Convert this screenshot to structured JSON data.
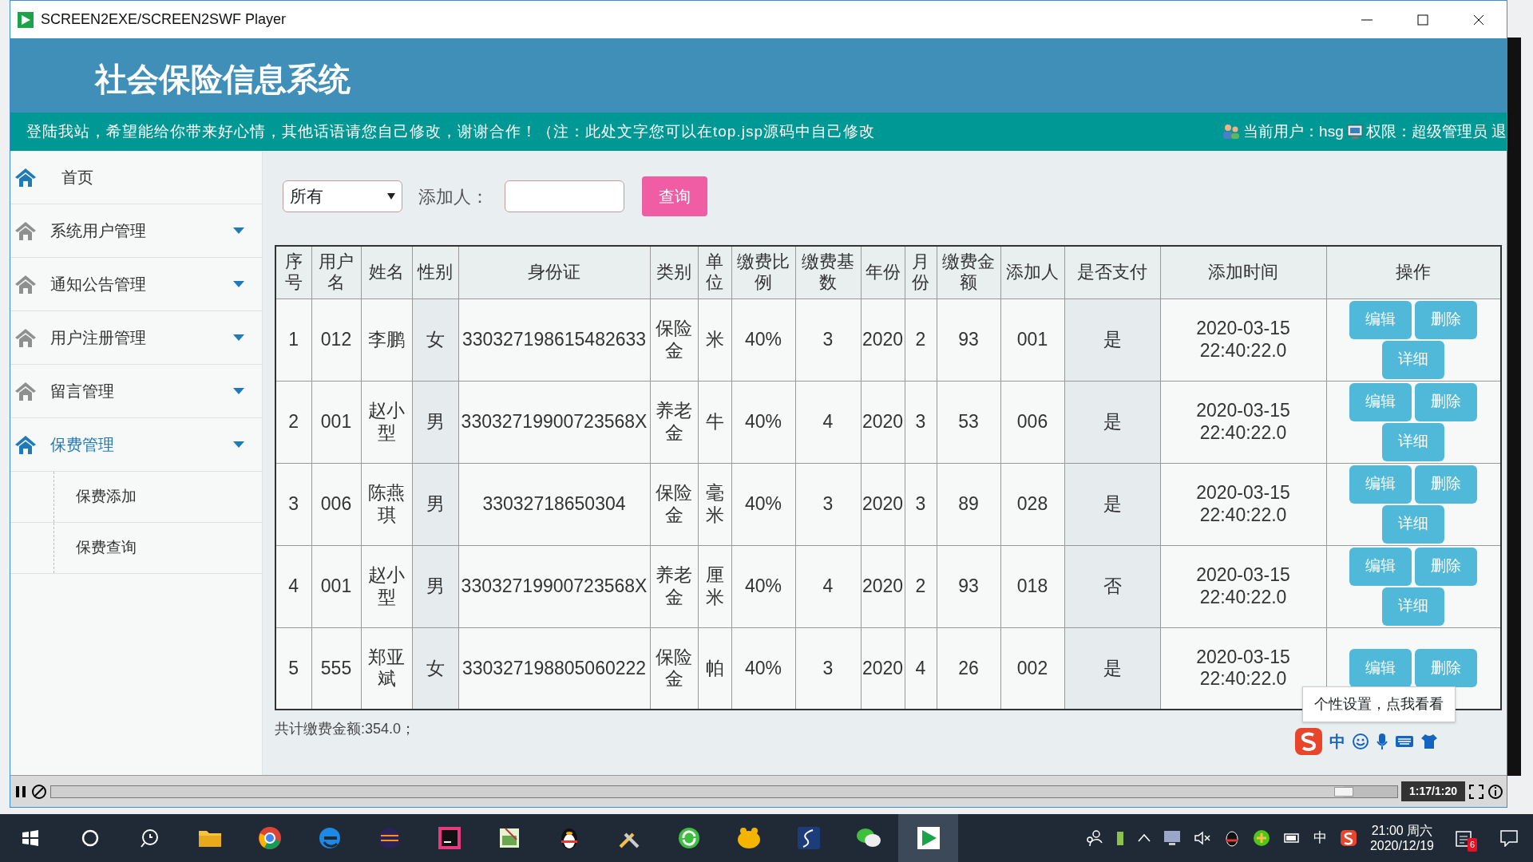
{
  "window": {
    "title": "SCREEN2EXE/SCREEN2SWF Player"
  },
  "header": {
    "title": "社会保险信息系统",
    "notice": "登陆我站，希望能给你带来好心情，其他话语请您自己修改，谢谢合作！（注：此处文字您可以在top.jsp源码中自己修改",
    "user": "当前用户：hsg",
    "role": "权限：超级管理员 退"
  },
  "sidebar": [
    {
      "label": "首页",
      "kind": "link"
    },
    {
      "label": "系统用户管理",
      "kind": "menu",
      "expanded": false
    },
    {
      "label": "通知公告管理",
      "kind": "menu",
      "expanded": false
    },
    {
      "label": "用户注册管理",
      "kind": "menu",
      "expanded": false
    },
    {
      "label": "留言管理",
      "kind": "menu",
      "expanded": false
    },
    {
      "label": "保费管理",
      "kind": "menu",
      "expanded": true,
      "children": [
        {
          "label": "保费添加"
        },
        {
          "label": "保费查询"
        }
      ]
    }
  ],
  "filter": {
    "select": "所有",
    "label": "添加人：",
    "button": "查询"
  },
  "table": {
    "columns": [
      "序号",
      "用户名",
      "姓名",
      "性别",
      "身份证",
      "类别",
      "单位",
      "缴费比例",
      "缴费基数",
      "年份",
      "月份",
      "缴费金额",
      "添加人",
      "是否支付",
      "添加时间",
      "操作"
    ],
    "rows": [
      {
        "cells": [
          "1",
          "012",
          "李鹏",
          "女",
          "330327198615482633",
          "保险金",
          "米",
          "40%",
          "3",
          "2020",
          "2",
          "93",
          "001",
          "是",
          "2020-03-15 22:40:22.0"
        ],
        "actions": [
          "编辑",
          "删除",
          "详细"
        ]
      },
      {
        "cells": [
          "2",
          "001",
          "赵小型",
          "男",
          "33032719900723568X",
          "养老金",
          "牛",
          "40%",
          "4",
          "2020",
          "3",
          "53",
          "006",
          "是",
          "2020-03-15 22:40:22.0"
        ],
        "actions": [
          "编辑",
          "删除",
          "详细"
        ]
      },
      {
        "cells": [
          "3",
          "006",
          "陈燕琪",
          "男",
          "33032718650304",
          "保险金",
          "毫米",
          "40%",
          "3",
          "2020",
          "3",
          "89",
          "028",
          "是",
          "2020-03-15 22:40:22.0"
        ],
        "actions": [
          "编辑",
          "删除",
          "详细"
        ]
      },
      {
        "cells": [
          "4",
          "001",
          "赵小型",
          "男",
          "33032719900723568X",
          "养老金",
          "厘米",
          "40%",
          "4",
          "2020",
          "2",
          "93",
          "018",
          "否",
          "2020-03-15 22:40:22.0"
        ],
        "actions": [
          "编辑",
          "删除",
          "详细"
        ]
      },
      {
        "cells": [
          "5",
          "555",
          "郑亚斌",
          "女",
          "330327198805060222",
          "保险金",
          "帕",
          "40%",
          "3",
          "2020",
          "4",
          "26",
          "002",
          "是",
          "2020-03-15 22:40:22.0"
        ],
        "actions": [
          "编辑",
          "删除"
        ]
      }
    ]
  },
  "total": "共计缴费金额:354.0；",
  "tooltip": "个性设置，点我看看",
  "ime": {
    "mode": "中"
  },
  "player": {
    "level": 0.96,
    "time": "1:17/1:20"
  },
  "taskbar": {
    "input": "中",
    "time": "21:00 周六",
    "date": "2020/12/19",
    "badge": "6"
  }
}
